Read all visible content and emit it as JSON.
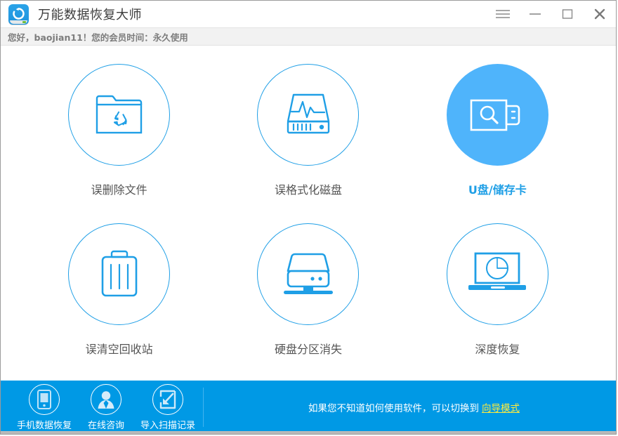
{
  "window": {
    "title": "万能数据恢复大师",
    "logo_icon": "refresh-circle-icon",
    "controls": [
      {
        "name": "menu",
        "icon": "hamburger-menu-icon"
      },
      {
        "name": "minimize",
        "icon": "minimize-icon"
      },
      {
        "name": "maximize",
        "icon": "maximize-icon"
      },
      {
        "name": "close",
        "icon": "close-icon"
      }
    ]
  },
  "greeting": {
    "text": "您好，baojian11！您的会员时间：永久使用"
  },
  "theme": {
    "accent": "#1f9fe6",
    "selected_fill": "#4fb4fb",
    "bottom_bar": "#0099e5",
    "link": "#ffec3d",
    "label": "#555555",
    "greeting_bg": "#f2f2f2"
  },
  "main": {
    "tiles": [
      {
        "label": "误删除文件",
        "icon": "folder-recycle-icon",
        "selected": false
      },
      {
        "label": "误格式化磁盘",
        "icon": "disk-pulse-icon",
        "selected": false
      },
      {
        "label": "U盘/储存卡",
        "icon": "usb-search-icon",
        "selected": true
      },
      {
        "label": "误清空回收站",
        "icon": "trash-bin-icon",
        "selected": false
      },
      {
        "label": "硬盘分区消失",
        "icon": "hard-drive-icon",
        "selected": false
      },
      {
        "label": "深度恢复",
        "icon": "laptop-scan-icon",
        "selected": false
      }
    ]
  },
  "bottom_bar": {
    "actions": [
      {
        "label": "手机数据恢复",
        "icon": "mobile-phone-icon"
      },
      {
        "label": "在线咨询",
        "icon": "user-support-icon"
      },
      {
        "label": "导入扫描记录",
        "icon": "import-arrow-icon"
      }
    ],
    "hint_text": "如果您不知道如何使用软件，可以切换到",
    "hint_link": "向导模式"
  }
}
